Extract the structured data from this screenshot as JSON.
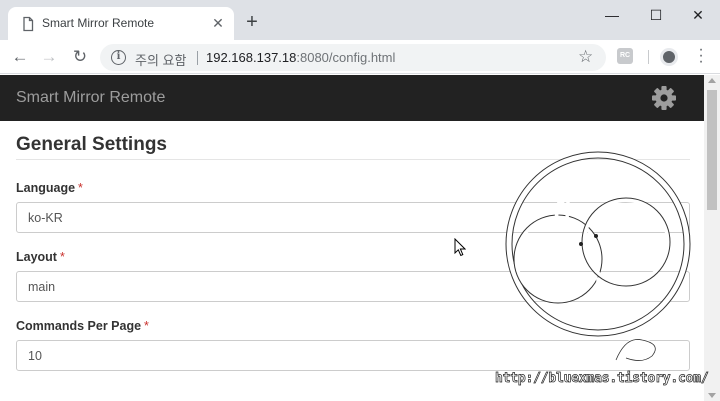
{
  "browser": {
    "tab": {
      "title": "Smart Mirror Remote",
      "page_icon": "page-icon",
      "close_icon": "close-icon"
    },
    "new_tab_label": "+",
    "window_controls": {
      "minimize": "—",
      "maximize": "☐",
      "close": "✕"
    },
    "nav": {
      "back": "←",
      "forward": "→",
      "reload": "↻"
    },
    "address": {
      "security_label": "주의 요함",
      "url_host": "192.168.137.18",
      "url_rest": ":8080/config.html"
    },
    "icons": [
      "info-icon",
      "star-icon",
      "extension-icon",
      "profile-icon",
      "menu-icon"
    ]
  },
  "app": {
    "brand": "Smart Mirror Remote",
    "settings_icon": "gear-icon"
  },
  "section": {
    "title": "General Settings",
    "fields": [
      {
        "label": "Language",
        "required_mark": "*",
        "value": "ko-KR"
      },
      {
        "label": "Layout",
        "required_mark": "*",
        "value": "main"
      },
      {
        "label": "Commands Per Page",
        "required_mark": "*",
        "value": "10"
      }
    ]
  },
  "watermark": {
    "url": "http://bluexmas.tistory.com/"
  },
  "colors": {
    "navbar": "#222222",
    "brand_text": "#9d9d9d",
    "required": "#c9302c",
    "tabstrip": "#dee1e6"
  }
}
